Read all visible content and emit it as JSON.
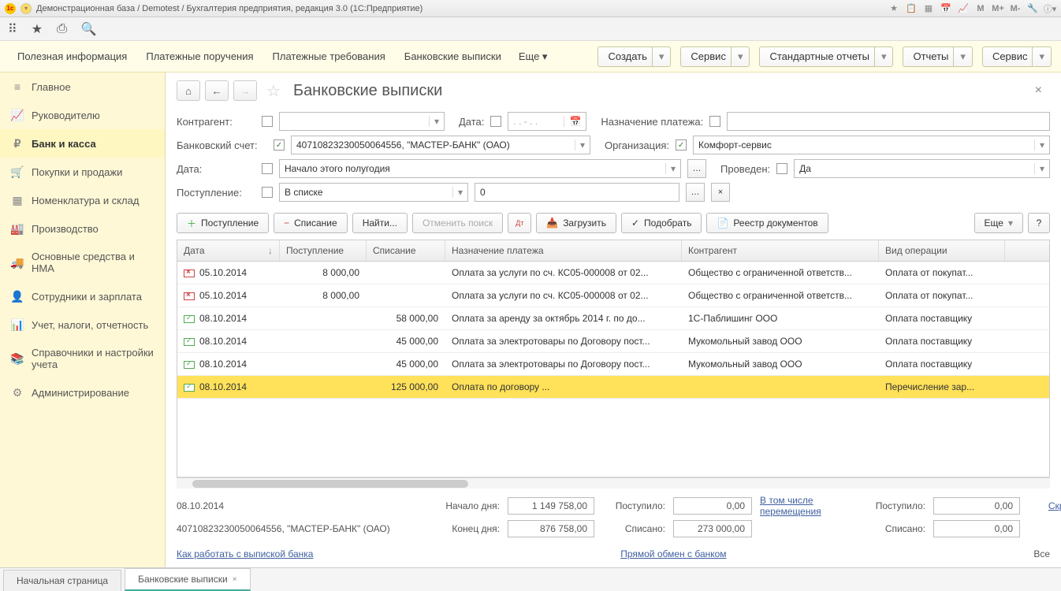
{
  "titlebar": {
    "title": "Демонстрационная база / Demotest / Бухгалтерия предприятия, редакция 3.0  (1С:Предприятие)",
    "sys_icons": [
      "★",
      "📋",
      "📊",
      "📅",
      "📈",
      "M",
      "M+",
      "M-",
      "🔧",
      "ⓘ"
    ]
  },
  "cmdbar": {
    "items": [
      "Полезная информация",
      "Платежные поручения",
      "Платежные требования",
      "Банковские выписки"
    ],
    "more": "Еще ▾",
    "buttons": [
      {
        "label": "Создать",
        "split": true
      },
      {
        "label": "Сервис",
        "split": true
      },
      {
        "label": "Стандартные отчеты",
        "split": true
      },
      {
        "label": "Отчеты",
        "split": true
      },
      {
        "label": "Сервис",
        "split": true
      }
    ]
  },
  "sidebar": {
    "items": [
      {
        "icon": "≡",
        "label": "Главное"
      },
      {
        "icon": "📈",
        "label": "Руководителю"
      },
      {
        "icon": "₽",
        "label": "Банк и касса",
        "active": true
      },
      {
        "icon": "🛒",
        "label": "Покупки и продажи"
      },
      {
        "icon": "▦",
        "label": "Номенклатура и склад"
      },
      {
        "icon": "🏭",
        "label": "Производство"
      },
      {
        "icon": "🚚",
        "label": "Основные средства и НМА"
      },
      {
        "icon": "👤",
        "label": "Сотрудники и зарплата"
      },
      {
        "icon": "📊",
        "label": "Учет, налоги, отчетность"
      },
      {
        "icon": "📚",
        "label": "Справочники и настройки учета"
      },
      {
        "icon": "⚙",
        "label": "Администрирование"
      }
    ]
  },
  "page": {
    "title": "Банковские выписки"
  },
  "filters": {
    "contractor_label": "Контрагент:",
    "date_label": "Дата:",
    "date_placeholder": ". .  -  . .",
    "purpose_label": "Назначение платежа:",
    "account_label": "Банковский счет:",
    "account_value": "40710823230050064556, \"МАСТЕР-БАНК\" (ОАО)",
    "org_label": "Организация:",
    "org_value": "Комфорт-сервис",
    "period_label": "Дата:",
    "period_value": "Начало этого полугодия",
    "posted_label": "Проведен:",
    "posted_value": "Да",
    "inflow_label": "Поступление:",
    "inflow_mode": "В списке",
    "inflow_value": "0"
  },
  "actions": {
    "inflow": "Поступление",
    "outflow": "Списание",
    "find": "Найти...",
    "cancel_find": "Отменить поиск",
    "load": "Загрузить",
    "pick": "Подобрать",
    "registry": "Реестр документов",
    "more": "Еще"
  },
  "grid": {
    "headers": {
      "date": "Дата",
      "in": "Поступление",
      "out": "Списание",
      "desc": "Назначение платежа",
      "contr": "Контрагент",
      "type": "Вид операции"
    },
    "rows": [
      {
        "icon": "red",
        "date": "05.10.2014",
        "in": "8 000,00",
        "out": "",
        "desc": "Оплата за услуги по сч. КС05-000008 от 02...",
        "contr": "Общество с ограниченной ответств...",
        "type": "Оплата от покупат..."
      },
      {
        "icon": "red",
        "date": "05.10.2014",
        "in": "8 000,00",
        "out": "",
        "desc": "Оплата за услуги по сч. КС05-000008 от 02...",
        "contr": "Общество с ограниченной ответств...",
        "type": "Оплата от покупат..."
      },
      {
        "icon": "green",
        "date": "08.10.2014",
        "in": "",
        "out": "58 000,00",
        "desc": "Оплата за аренду за октябрь 2014 г. по до...",
        "contr": "1С-Паблишинг ООО",
        "type": "Оплата поставщику"
      },
      {
        "icon": "green",
        "date": "08.10.2014",
        "in": "",
        "out": "45 000,00",
        "desc": "Оплата за электротовары по Договору пост...",
        "contr": "Мукомольный завод ООО",
        "type": "Оплата поставщику"
      },
      {
        "icon": "green",
        "date": "08.10.2014",
        "in": "",
        "out": "45 000,00",
        "desc": "Оплата за электротовары по Договору пост...",
        "contr": "Мукомольный завод ООО",
        "type": "Оплата поставщику"
      },
      {
        "icon": "green",
        "date": "08.10.2014",
        "in": "",
        "out": "125 000,00",
        "desc": "Оплата по договору ...",
        "contr": "",
        "type": "Перечисление зар...",
        "selected": true
      }
    ]
  },
  "summary": {
    "date": "08.10.2014",
    "account": "40710823230050064556, \"МАСТЕР-БАНК\" (ОАО)",
    "start_label": "Начало дня:",
    "start_val": "1 149 758,00",
    "end_label": "Конец дня:",
    "end_val": "876 758,00",
    "in_label": "Поступило:",
    "in_val": "0,00",
    "out_label": "Списано:",
    "out_val": "273 000,00",
    "transfers_link": "В том числе перемещения",
    "in2_label": "Поступило:",
    "in2_val": "0,00",
    "out2_label": "Списано:",
    "out2_val": "0,00",
    "hide_link": "Скрыть итоги"
  },
  "footer_links": {
    "how": "Как работать с выпиской банка",
    "exchange": "Прямой обмен с банком",
    "all": "Все"
  },
  "tabs": {
    "start": "Начальная страница",
    "active": "Банковские выписки"
  }
}
